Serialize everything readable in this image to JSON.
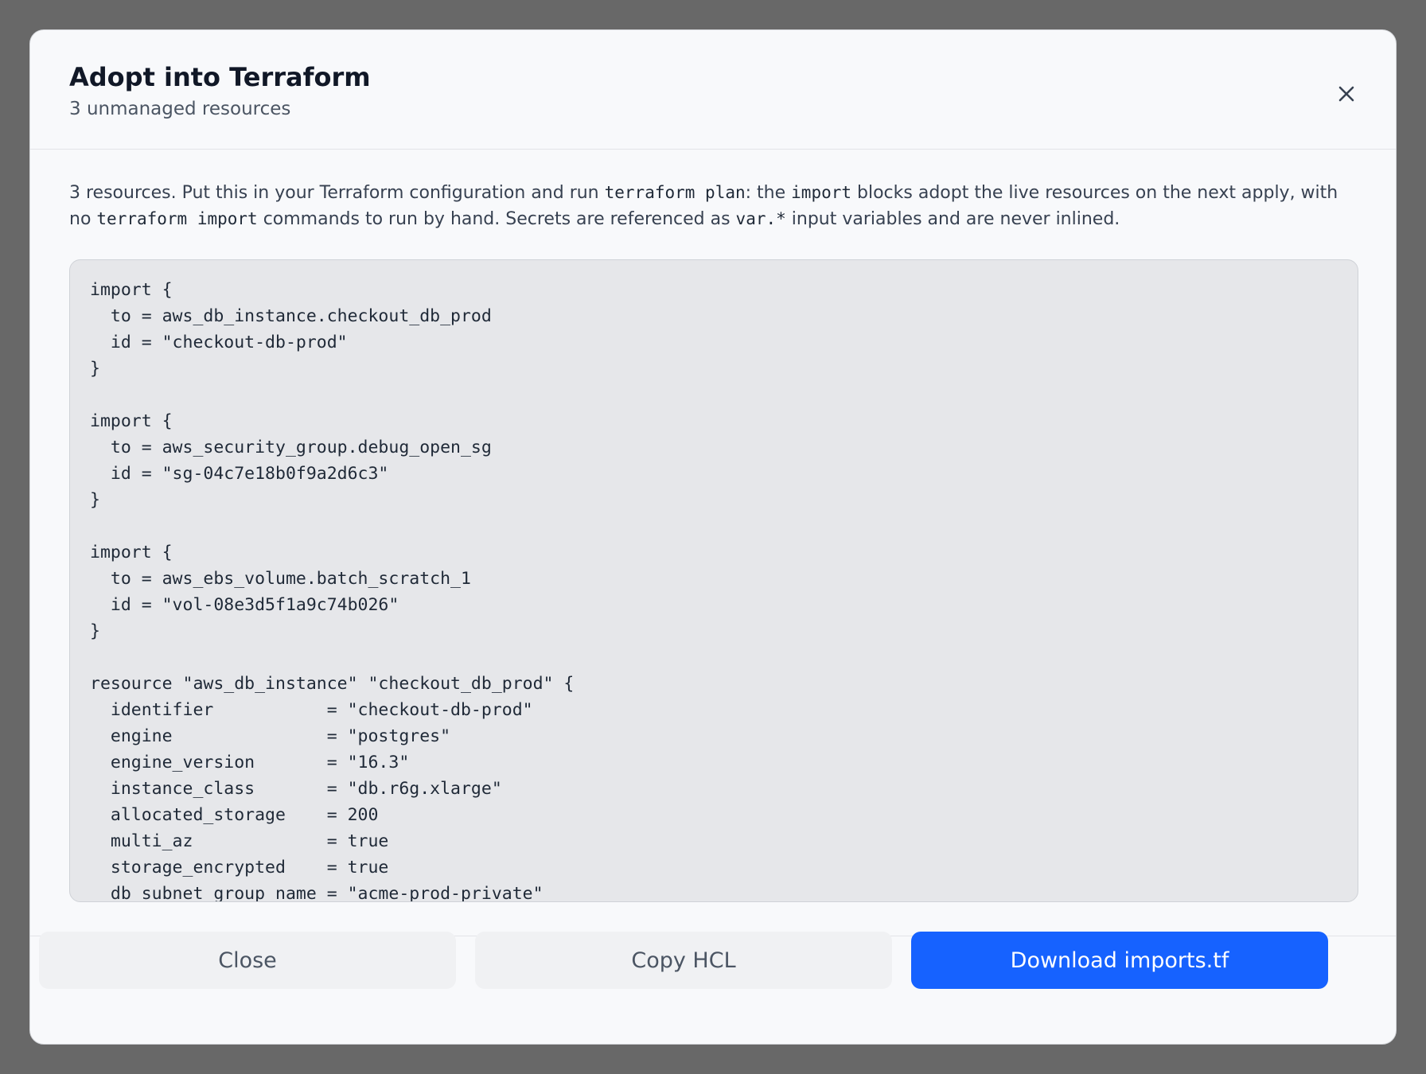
{
  "modal": {
    "title": "Adopt into Terraform",
    "subtitle": "3 unmanaged resources",
    "close_icon": "close-icon"
  },
  "description": {
    "part1": "3 resources. Put this in your Terraform configuration and run ",
    "code1": "terraform plan",
    "part2": ": the ",
    "code2": "import",
    "part3": " blocks adopt the live resources on the next apply, with no ",
    "code3": "terraform import",
    "part4": " commands to run by hand. Secrets are referenced as ",
    "code4": "var.*",
    "part5": " input variables and are never inlined."
  },
  "code": {
    "hcl": "import {\n  to = aws_db_instance.checkout_db_prod\n  id = \"checkout-db-prod\"\n}\n\nimport {\n  to = aws_security_group.debug_open_sg\n  id = \"sg-04c7e18b0f9a2d6c3\"\n}\n\nimport {\n  to = aws_ebs_volume.batch_scratch_1\n  id = \"vol-08e3d5f1a9c74b026\"\n}\n\nresource \"aws_db_instance\" \"checkout_db_prod\" {\n  identifier           = \"checkout-db-prod\"\n  engine               = \"postgres\"\n  engine_version       = \"16.3\"\n  instance_class       = \"db.r6g.xlarge\"\n  allocated_storage    = 200\n  multi_az             = true\n  storage_encrypted    = true\n  db_subnet_group_name = \"acme-prod-private\""
  },
  "footer": {
    "close_label": "Close",
    "copy_label": "Copy HCL",
    "download_label": "Download imports.tf"
  },
  "colors": {
    "primary": "#1662ff",
    "secondary_button": "#f0f1f3",
    "code_background": "#e6e7ea",
    "backdrop": "#686868"
  }
}
